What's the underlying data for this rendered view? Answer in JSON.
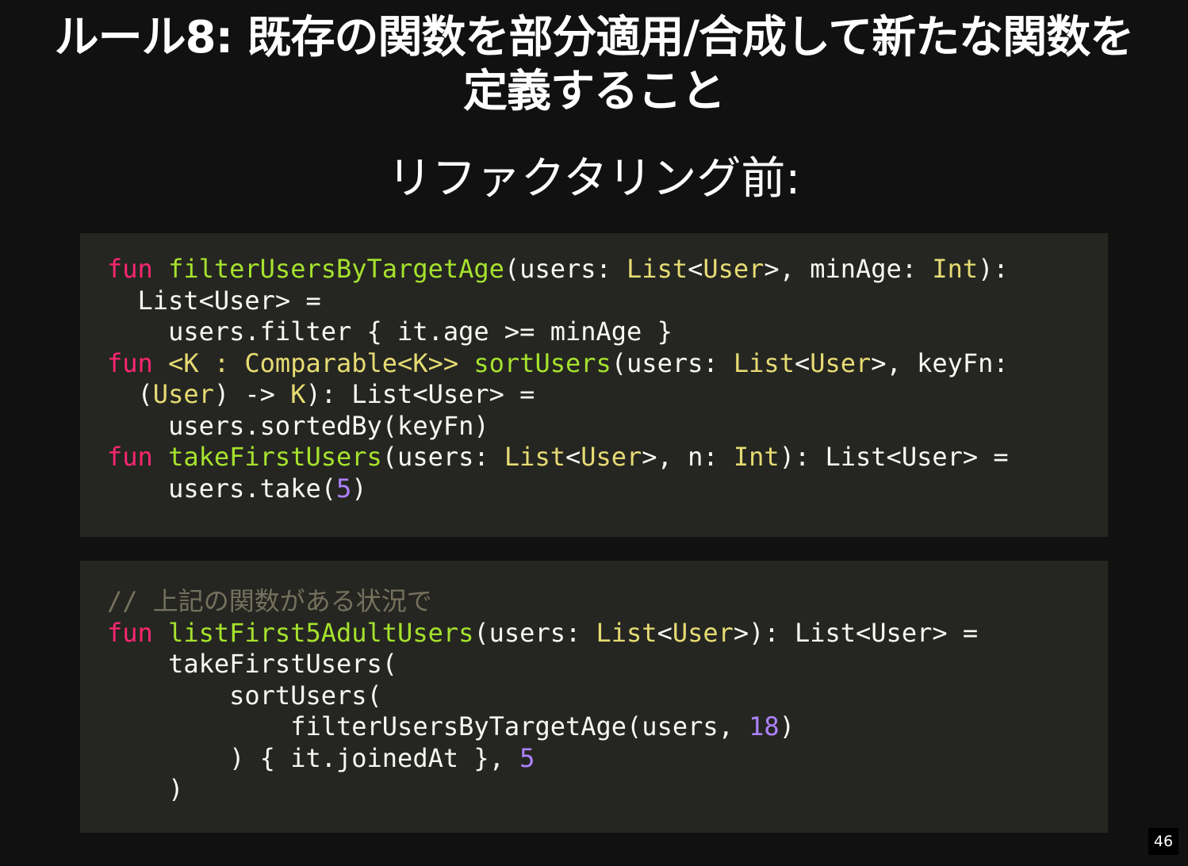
{
  "slide": {
    "title_line1": "ルール8: 既存の関数を部分適用/合成して新たな関数を",
    "title_line2": "定義すること",
    "subtitle": "リファクタリング前:",
    "page_number": "46"
  },
  "colors": {
    "background": "#111111",
    "code_background": "#252621",
    "code_text": "#f8f8f2",
    "keyword": "#f92672",
    "function_name": "#a6e22e",
    "type": "#e6db74",
    "number": "#ae81ff",
    "comment": "#75715e"
  },
  "code_before": [
    [
      {
        "t": "fun",
        "c": "kw"
      },
      {
        "t": " ",
        "c": ""
      },
      {
        "t": "filterUsersByTargetAge",
        "c": "fn"
      },
      {
        "t": "(users: ",
        "c": ""
      },
      {
        "t": "List",
        "c": "ty"
      },
      {
        "t": "<",
        "c": ""
      },
      {
        "t": "User",
        "c": "ty"
      },
      {
        "t": ">, minAge: ",
        "c": ""
      },
      {
        "t": "Int",
        "c": "ty"
      },
      {
        "t": "):",
        "c": ""
      }
    ],
    [
      {
        "t": "  List<User> =",
        "c": ""
      }
    ],
    [
      {
        "t": "    users.filter { it.age >= minAge }",
        "c": ""
      }
    ],
    [
      {
        "t": "fun",
        "c": "kw"
      },
      {
        "t": " ",
        "c": ""
      },
      {
        "t": "<K : Comparable<K>>",
        "c": "ty"
      },
      {
        "t": " ",
        "c": ""
      },
      {
        "t": "sortUsers",
        "c": "fn"
      },
      {
        "t": "(users: ",
        "c": ""
      },
      {
        "t": "List",
        "c": "ty"
      },
      {
        "t": "<",
        "c": ""
      },
      {
        "t": "User",
        "c": "ty"
      },
      {
        "t": ">, keyFn:",
        "c": ""
      }
    ],
    [
      {
        "t": "  (",
        "c": ""
      },
      {
        "t": "User",
        "c": "ty"
      },
      {
        "t": ") -> ",
        "c": ""
      },
      {
        "t": "K",
        "c": "ty"
      },
      {
        "t": "): List<User> =",
        "c": ""
      }
    ],
    [
      {
        "t": "    users.sortedBy(keyFn)",
        "c": ""
      }
    ],
    [
      {
        "t": "fun",
        "c": "kw"
      },
      {
        "t": " ",
        "c": ""
      },
      {
        "t": "takeFirstUsers",
        "c": "fn"
      },
      {
        "t": "(users: ",
        "c": ""
      },
      {
        "t": "List",
        "c": "ty"
      },
      {
        "t": "<",
        "c": ""
      },
      {
        "t": "User",
        "c": "ty"
      },
      {
        "t": ">, n: ",
        "c": ""
      },
      {
        "t": "Int",
        "c": "ty"
      },
      {
        "t": "): List<User> =",
        "c": ""
      }
    ],
    [
      {
        "t": "    users.take(",
        "c": ""
      },
      {
        "t": "5",
        "c": "num"
      },
      {
        "t": ")",
        "c": ""
      }
    ]
  ],
  "code_after": [
    [
      {
        "t": "// 上記の関数がある状況で",
        "c": "cm"
      }
    ],
    [
      {
        "t": "fun",
        "c": "kw"
      },
      {
        "t": " ",
        "c": ""
      },
      {
        "t": "listFirst5AdultUsers",
        "c": "fn"
      },
      {
        "t": "(users: ",
        "c": ""
      },
      {
        "t": "List",
        "c": "ty"
      },
      {
        "t": "<",
        "c": ""
      },
      {
        "t": "User",
        "c": "ty"
      },
      {
        "t": ">): List<User> =",
        "c": ""
      }
    ],
    [
      {
        "t": "    takeFirstUsers(",
        "c": ""
      }
    ],
    [
      {
        "t": "        sortUsers(",
        "c": ""
      }
    ],
    [
      {
        "t": "            filterUsersByTargetAge(users, ",
        "c": ""
      },
      {
        "t": "18",
        "c": "num"
      },
      {
        "t": ")",
        "c": ""
      }
    ],
    [
      {
        "t": "        ) { it.joinedAt }, ",
        "c": ""
      },
      {
        "t": "5",
        "c": "num"
      }
    ],
    [
      {
        "t": "    )",
        "c": ""
      }
    ]
  ]
}
